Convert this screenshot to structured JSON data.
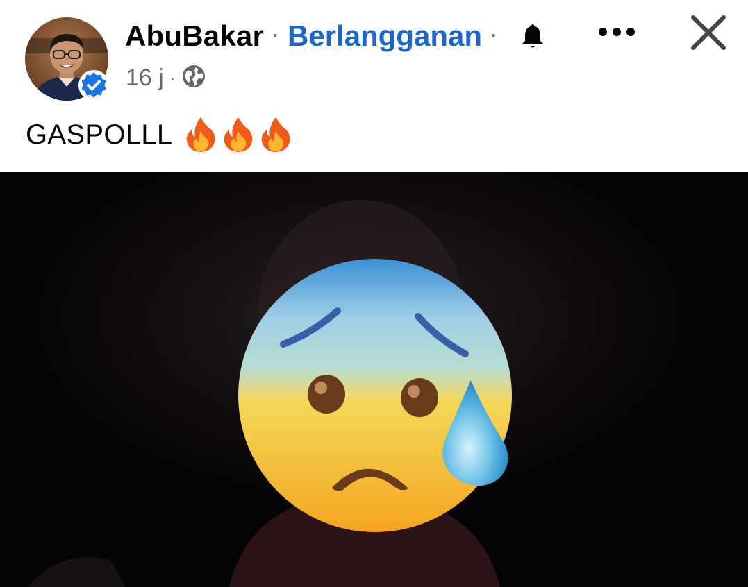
{
  "post": {
    "author": {
      "name": "AbuBakar",
      "verified": true,
      "avatar_icon": "profile-photo"
    },
    "separator": "·",
    "subscribe_label": "Berlangganan",
    "bell_icon": "bell-icon",
    "more_icon": "more-options-icon",
    "close_icon": "close-icon",
    "timestamp": "16 j",
    "audience_icon": "globe-icon",
    "caption": "GASPOLLL",
    "caption_emoji": [
      "fire",
      "fire",
      "fire"
    ],
    "media": {
      "type": "video-frame",
      "overlay_emoji": "anxious-face-with-sweat"
    }
  },
  "colors": {
    "link": "#1b66c9",
    "text": "#050505",
    "secondary": "#65676b",
    "verified": "#1b74e4",
    "media_bg": "#050405"
  }
}
